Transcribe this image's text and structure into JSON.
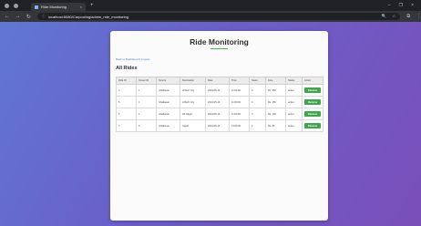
{
  "browser": {
    "tab_title": "Ride Monitoring",
    "tab_close": "×",
    "new_tab": "+",
    "window_controls": [
      "–",
      "❐",
      "×"
    ],
    "nav": {
      "back": "←",
      "forward": "→",
      "reload": "↻"
    },
    "url": "localhost:8080/Carpooling/admin_ride_monitoring",
    "toolbar_icons": [
      "🔍",
      "☆",
      "⋮"
    ]
  },
  "page": {
    "title": "Ride Monitoring",
    "back_link": "Back to Dashboard | Logout",
    "section_title": "All Rides"
  },
  "table": {
    "headers": [
      "Ride ID",
      "Owner ID",
      "Source",
      "Destination",
      "Date",
      "Time",
      "Seats",
      "Fare",
      "Status",
      "Action"
    ],
    "action_label": "Remove",
    "rows": [
      [
        "4",
        "1",
        "Ghatkesar",
        "HiTech City",
        "2024-05-14",
        "11:00:00",
        "4",
        "Rs. 150",
        "active"
      ],
      [
        "5",
        "1",
        "Ghatkesar",
        "HiTech City",
        "2024-05-14",
        "11:00:00",
        "4",
        "Rs. 150",
        "active"
      ],
      [
        "6",
        "1",
        "Ghatkesar",
        "LB Nagar",
        "2024-05-14",
        "11:00:00",
        "3",
        "Rs. 100",
        "active"
      ],
      [
        "7",
        "6",
        "Ghatkesar",
        "Uppal",
        "2024-05-14",
        "14:00:00",
        "2",
        "Rs. 80",
        "active"
      ]
    ]
  },
  "colors": {
    "accent": "#4fb05a",
    "button": "#3fa64b",
    "link": "#3b82d6",
    "background_start": "#5f78d6",
    "background_end": "#7a4fb8"
  }
}
